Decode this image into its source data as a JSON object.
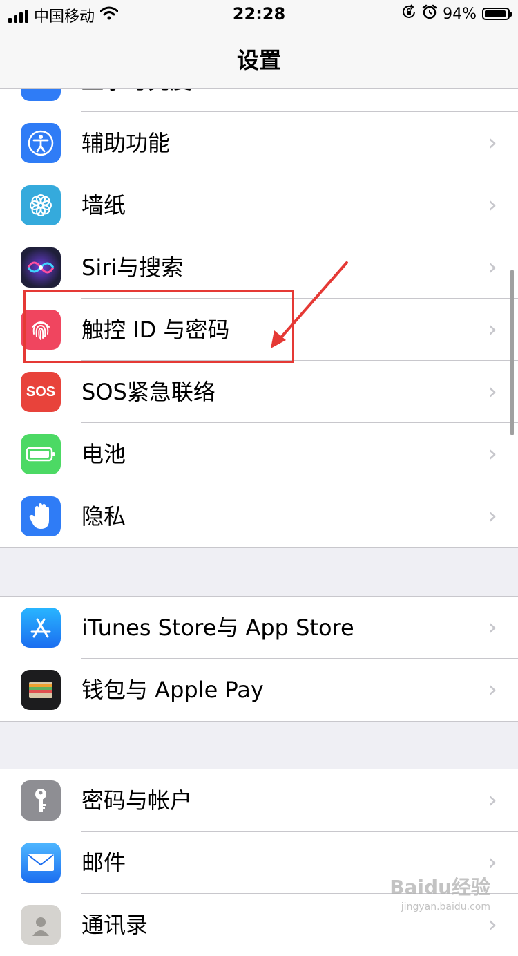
{
  "status_bar": {
    "carrier": "中国移动",
    "time": "22:28",
    "battery_percent": "94%",
    "battery_level": 0.94
  },
  "nav": {
    "title": "设置"
  },
  "group1": {
    "partial_top_label": "显示与亮度",
    "items": [
      {
        "label": "辅助功能",
        "icon": "accessibility-icon",
        "color": "#2f7cf6"
      },
      {
        "label": "墙纸",
        "icon": "wallpaper-icon",
        "color": "#35aadc"
      },
      {
        "label": "Siri与搜索",
        "icon": "siri-icon",
        "color": "#1f1f3a"
      },
      {
        "label": "触控 ID 与密码",
        "icon": "fingerprint-icon",
        "color": "#f0455f"
      },
      {
        "label": "SOS紧急联络",
        "icon": "sos-icon",
        "color": "#e8433b"
      },
      {
        "label": "电池",
        "icon": "battery-icon",
        "color": "#4cd964"
      },
      {
        "label": "隐私",
        "icon": "hand-icon",
        "color": "#2f7cf6"
      }
    ]
  },
  "group2": {
    "items": [
      {
        "label": "iTunes Store与 App Store",
        "icon": "app-store-icon",
        "color": "#1e90fb"
      },
      {
        "label": "钱包与 Apple Pay",
        "icon": "wallet-icon",
        "color": "#1c1c1e"
      }
    ]
  },
  "group3": {
    "items": [
      {
        "label": "密码与帐户",
        "icon": "key-icon",
        "color": "#8e8e93"
      },
      {
        "label": "邮件",
        "icon": "mail-icon",
        "color": "#2d8cf0"
      },
      {
        "label": "通讯录",
        "icon": "contacts-icon",
        "color": "#d5d3cf"
      }
    ]
  },
  "chevron": "›",
  "watermark": {
    "brand": "Baidu经验",
    "url": "jingyan.baidu.com"
  }
}
